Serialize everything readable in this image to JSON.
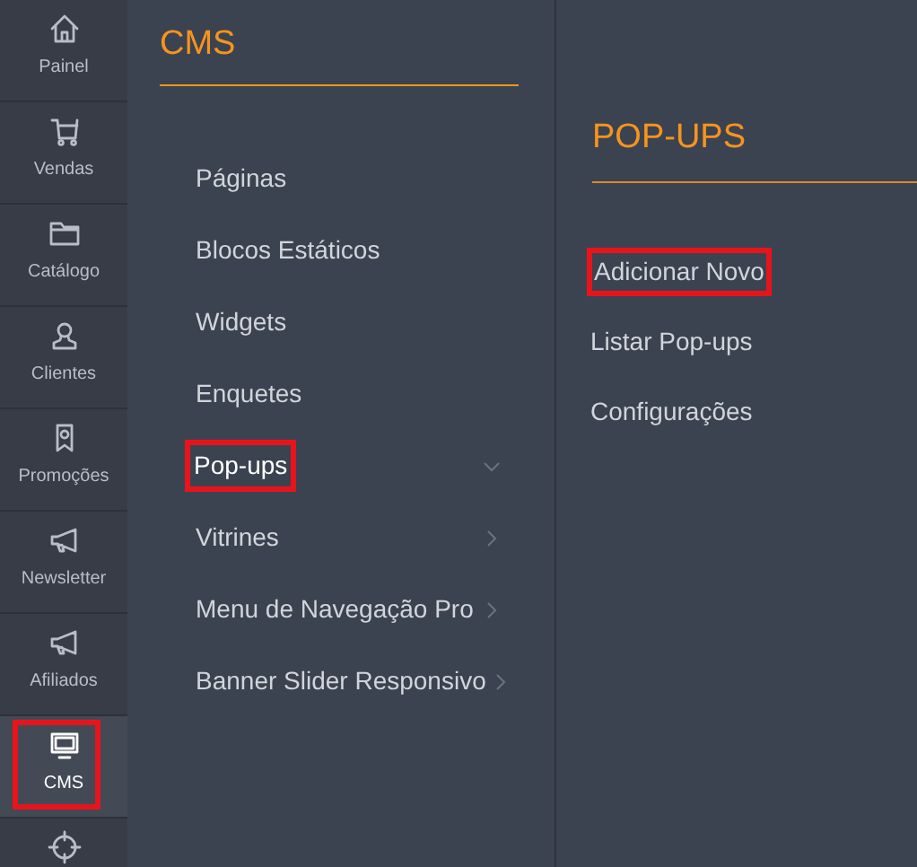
{
  "sidebar": {
    "items": [
      {
        "label": "Painel",
        "selected": false,
        "highlighted": false
      },
      {
        "label": "Vendas",
        "selected": false,
        "highlighted": false
      },
      {
        "label": "Catálogo",
        "selected": false,
        "highlighted": false
      },
      {
        "label": "Clientes",
        "selected": false,
        "highlighted": false
      },
      {
        "label": "Promoções",
        "selected": false,
        "highlighted": false
      },
      {
        "label": "Newsletter",
        "selected": false,
        "highlighted": false
      },
      {
        "label": "Afiliados",
        "selected": false,
        "highlighted": false
      },
      {
        "label": "CMS",
        "selected": true,
        "highlighted": true
      },
      {
        "selected": false,
        "highlighted": false
      }
    ]
  },
  "cms_menu": {
    "title": "CMS",
    "items": [
      {
        "label": "Páginas",
        "kind": "link",
        "selected": false,
        "highlighted": false
      },
      {
        "label": "Blocos Estáticos",
        "kind": "link",
        "selected": false,
        "highlighted": false
      },
      {
        "label": "Widgets",
        "kind": "link",
        "selected": false,
        "highlighted": false
      },
      {
        "label": "Enquetes",
        "kind": "link",
        "selected": false,
        "highlighted": false
      },
      {
        "label": "Pop-ups",
        "kind": "submenu",
        "expanded": true,
        "selected": true,
        "highlighted": true
      },
      {
        "label": "Vitrines",
        "kind": "submenu",
        "expanded": false,
        "selected": false,
        "highlighted": false
      },
      {
        "label": "Menu de Navegação Pro",
        "kind": "submenu",
        "expanded": false,
        "selected": false,
        "highlighted": false
      },
      {
        "label": "Banner Slider Responsivo",
        "kind": "submenu",
        "expanded": false,
        "selected": false,
        "highlighted": false
      }
    ]
  },
  "submenu": {
    "title": "POP-UPS",
    "items": [
      {
        "label": "Adicionar Novo",
        "highlighted": true
      },
      {
        "label": "Listar Pop-ups",
        "highlighted": false
      },
      {
        "label": "Configurações",
        "highlighted": false
      }
    ]
  }
}
